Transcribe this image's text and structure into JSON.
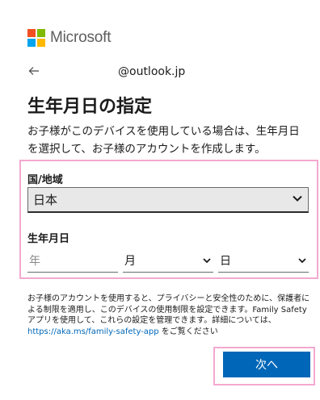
{
  "brand": {
    "name": "Microsoft",
    "colors": [
      "#f25022",
      "#7fba00",
      "#00a4ef",
      "#ffb900"
    ]
  },
  "identity": {
    "back_icon": "back-arrow-icon",
    "email": "@outlook.jp"
  },
  "title": "生年月日の指定",
  "description": "お子様がこのデバイスを使用している場合は、生年月日を選択して、お子様のアカウントを作成します。",
  "form": {
    "region_label": "国/地域",
    "region_value": "日本",
    "dob_label": "生年月日",
    "year_placeholder": "年",
    "month_value": "月",
    "day_value": "日"
  },
  "privacy": {
    "text": "お子様のアカウントを使用すると、プライバシーと安全性のために、保護者による制限を適用し、このデバイスの使用制限を設定できます。Family Safety アプリを使用して、これらの設定を管理できます。詳細については、",
    "link": "https://aka.ms/family-safety-app",
    "suffix": " をご覧ください"
  },
  "next_button": "次へ",
  "accent_color": "#0067b8",
  "highlight_color": "#f3a9cf"
}
